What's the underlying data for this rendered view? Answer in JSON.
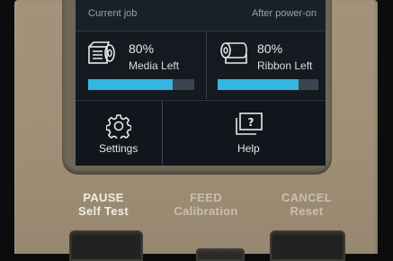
{
  "screen": {
    "status": {
      "left": "Current job",
      "right": "After power-on"
    },
    "media": {
      "percent_text": "80%",
      "label": "Media Left",
      "level": 0.8,
      "icon": "media-roll-icon"
    },
    "ribbon": {
      "percent_text": "80%",
      "label": "Ribbon Left",
      "level": 0.8,
      "icon": "ribbon-roll-icon"
    },
    "buttons": [
      {
        "label": "Settings",
        "icon": "gear-icon"
      },
      {
        "label": "Help",
        "icon": "help-icon"
      }
    ]
  },
  "hardware": {
    "pause": {
      "primary": "PAUSE",
      "secondary": "Self Test"
    },
    "feed": {
      "primary": "FEED",
      "secondary": "Calibration"
    },
    "cancel": {
      "primary": "CANCEL",
      "secondary": "Reset"
    }
  },
  "colors": {
    "accent": "#33b6e0",
    "bar_track": "#3b4450",
    "device_body": "#a3937b"
  }
}
